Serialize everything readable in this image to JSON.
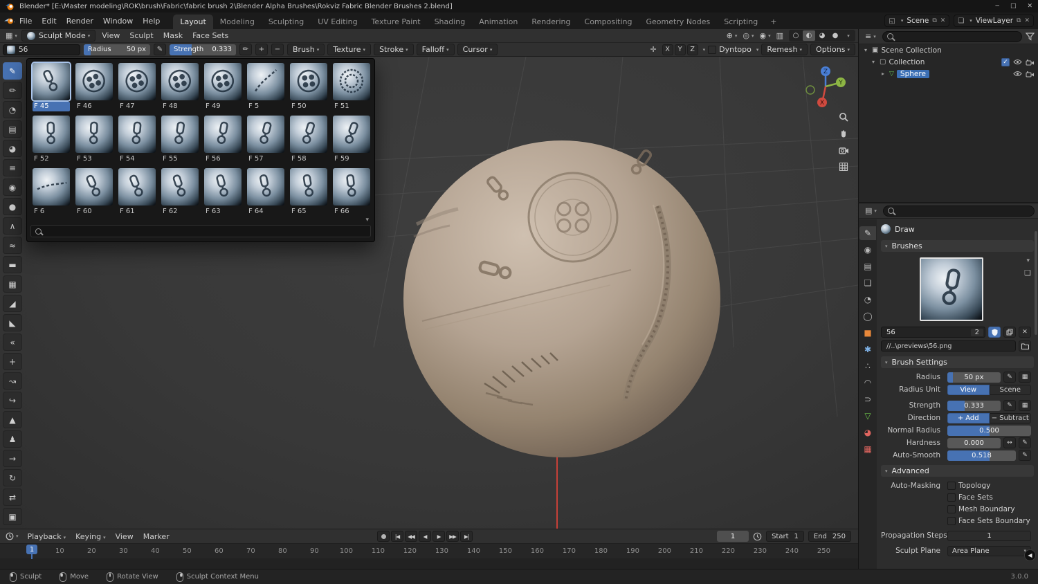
{
  "titlebar": {
    "title": "Blender* [E:\\Master modeling\\ROK\\brush\\Fabric\\fabric brush 2\\Blender Alpha Brushes\\Rokviz Fabric Blender Brushes 2.blend]"
  },
  "menubar": {
    "menus": [
      "File",
      "Edit",
      "Render",
      "Window",
      "Help"
    ],
    "tabs": [
      "Layout",
      "Modeling",
      "Sculpting",
      "UV Editing",
      "Texture Paint",
      "Shading",
      "Animation",
      "Rendering",
      "Compositing",
      "Geometry Nodes",
      "Scripting"
    ],
    "active_tab": "Layout",
    "new_tab": "+",
    "scene_label": "Scene",
    "viewlayer_label": "ViewLayer"
  },
  "viewport_header": {
    "mode": "Sculpt Mode",
    "menus": [
      "View",
      "Sculpt",
      "Mask",
      "Face Sets"
    ]
  },
  "viewport": {
    "gizmo_axes": {
      "x": "X",
      "y": "Y",
      "z": "Z"
    }
  },
  "tool_bar": {
    "brush_number": "56",
    "radius_label": "Radius",
    "radius_value": "50 px",
    "strength_label": "Strength",
    "strength_value": "0.333",
    "menus": [
      "Brush",
      "Texture",
      "Stroke",
      "Falloff",
      "Cursor"
    ],
    "mirror": [
      "X",
      "Y",
      "Z"
    ],
    "dyntopo_label": "Dyntopo",
    "remesh_label": "Remesh",
    "options_label": "Options"
  },
  "brush_popup": {
    "brushes": [
      "F 45",
      "F 46",
      "F 47",
      "F 48",
      "F 49",
      "F 5",
      "F 50",
      "F 51",
      "F 52",
      "F 53",
      "F 54",
      "F 55",
      "F 56",
      "F 57",
      "F 58",
      "F 59",
      "F 6",
      "F 60",
      "F 61",
      "F 62",
      "F 63",
      "F 64",
      "F 65",
      "F 66"
    ],
    "patterns": [
      "zipper",
      "button",
      "button",
      "button",
      "button",
      "seam",
      "button",
      "knit",
      "zipper",
      "zipper",
      "zipper",
      "zipper",
      "zipper",
      "zipper",
      "zipper",
      "zipper",
      "seam",
      "zipper",
      "zipper",
      "zipper",
      "zipper",
      "zipper",
      "zipper",
      "zipper"
    ],
    "selected_index": 0,
    "search_value": ""
  },
  "left_toolbar": {
    "tools": [
      "draw",
      "draw-sharp",
      "clay",
      "clay-strips",
      "clay-thumb",
      "layer",
      "inflate",
      "blob",
      "crease",
      "smooth",
      "flatten",
      "fill",
      "scrape",
      "multi-plane-scrape",
      "pinch",
      "grab",
      "elastic-deform",
      "snake-hook",
      "thumb",
      "pose",
      "nudge",
      "rotate",
      "slide-relax",
      "boundary"
    ],
    "active_index": 0
  },
  "outliner": {
    "items": [
      {
        "label": "Scene Collection"
      },
      {
        "label": "Collection"
      },
      {
        "label": "Sphere"
      }
    ]
  },
  "properties": {
    "tabs": [
      "tool",
      "render",
      "output",
      "view-layer",
      "scene",
      "world",
      "object",
      "modifiers",
      "particles",
      "physics",
      "constraints",
      "object-data",
      "material",
      "texture"
    ],
    "brush_name": "Draw",
    "sections": {
      "brushes": "Brushes",
      "brush_settings": "Brush Settings",
      "advanced": "Advanced"
    },
    "preview": {
      "number": "56",
      "users": "2",
      "path": "//..\\previews\\56.png"
    },
    "settings": {
      "radius_label": "Radius",
      "radius_value": "50 px",
      "radius_unit_label": "Radius Unit",
      "radius_unit_options": [
        "View",
        "Scene"
      ],
      "radius_unit_active": "View",
      "strength_label": "Strength",
      "strength_value": "0.333",
      "direction_label": "Direction",
      "direction_options": [
        "Add",
        "Subtract"
      ],
      "direction_active": "Add",
      "normal_radius_label": "Normal Radius",
      "normal_radius_value": "0.500",
      "hardness_label": "Hardness",
      "hardness_value": "0.000",
      "autosmooth_label": "Auto-Smooth",
      "autosmooth_value": "0.518"
    },
    "advanced": {
      "automasking_label": "Auto-Masking",
      "checkboxes": [
        "Topology",
        "Face Sets",
        "Mesh Boundary",
        "Face Sets Boundary"
      ],
      "propagation_label": "Propagation Steps",
      "propagation_value": "1",
      "sculpt_plane_label": "Sculpt Plane",
      "sculpt_plane_value": "Area Plane"
    }
  },
  "timeline": {
    "menus": [
      "Playback",
      "Keying",
      "View",
      "Marker"
    ],
    "transport": [
      "jump-to-start",
      "previous-keyframe",
      "play-reverse",
      "play",
      "next-keyframe",
      "jump-to-end"
    ],
    "current_frame": "1",
    "start_label": "Start",
    "start_value": "1",
    "end_label": "End",
    "end_value": "250",
    "ruler": [
      "10",
      "20",
      "30",
      "40",
      "50",
      "60",
      "70",
      "80",
      "90",
      "100",
      "110",
      "120",
      "130",
      "140",
      "150",
      "160",
      "170",
      "180",
      "190",
      "200",
      "210",
      "220",
      "230",
      "240",
      "250"
    ]
  },
  "statusbar": {
    "items": [
      {
        "label": "Sculpt",
        "button": "left"
      },
      {
        "label": "Move",
        "button": "left"
      },
      {
        "label": "Rotate View",
        "button": "middle"
      },
      {
        "label": "Sculpt Context Menu",
        "button": "right"
      }
    ],
    "version": "3.0.0"
  },
  "colors": {
    "accent": "#4772b3",
    "clay": "#b4a392",
    "axis_x": "#e0423a"
  }
}
